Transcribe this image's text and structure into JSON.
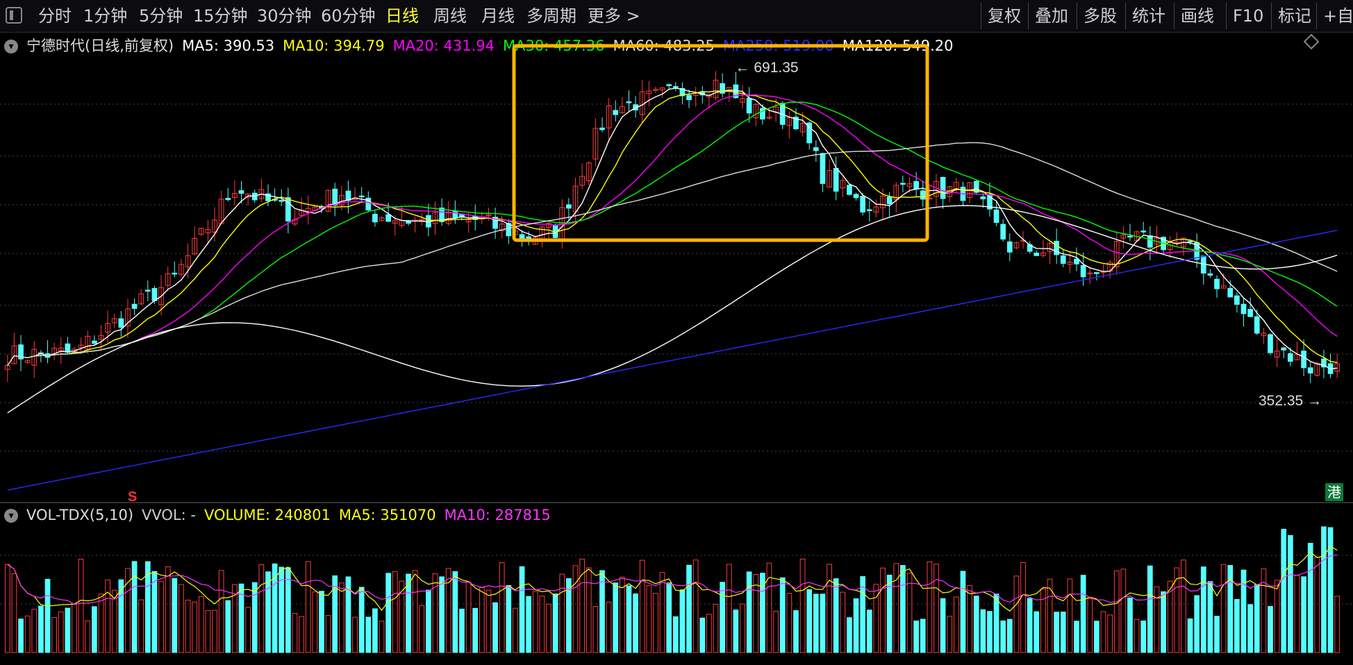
{
  "toolbar": {
    "periods": [
      "分时",
      "1分钟",
      "5分钟",
      "15分钟",
      "30分钟",
      "60分钟",
      "日线",
      "周线",
      "月线",
      "多周期",
      "更多 >"
    ],
    "active_period": "日线",
    "tools": [
      "复权",
      "叠加",
      "多股",
      "统计",
      "画线",
      "F10",
      "标记",
      "+自选"
    ]
  },
  "main_legend": {
    "title": "宁德时代(日线,前复权)",
    "items": [
      {
        "label": "MA5:",
        "value": "390.53",
        "color": "#ffffff"
      },
      {
        "label": "MA10:",
        "value": "394.79",
        "color": "#ffff00"
      },
      {
        "label": "MA20:",
        "value": "431.94",
        "color": "#ff00ff"
      },
      {
        "label": "MA30:",
        "value": "457.36",
        "color": "#00ff00"
      },
      {
        "label": "MA60:",
        "value": "483.25",
        "color": "#dddddd"
      },
      {
        "label": "MA250:",
        "value": "519.00",
        "color": "#2b2bff"
      },
      {
        "label": "MA120:",
        "value": "549.20",
        "color": "#ffffff"
      }
    ]
  },
  "volume_legend": {
    "title": "VOL-TDX(5,10)",
    "items": [
      {
        "label": "VVOL:",
        "value": "-",
        "color": "#cccccc"
      },
      {
        "label": "VOLUME:",
        "value": "240801",
        "color": "#ffff00"
      },
      {
        "label": "MA5:",
        "value": "351070",
        "color": "#ffff00"
      },
      {
        "label": "MA10:",
        "value": "287815",
        "color": "#ff33ff"
      }
    ]
  },
  "annotations": {
    "high_label": "691.35",
    "low_label": "352.35",
    "s_marker": "S",
    "hk_badge": "港"
  },
  "colors": {
    "up": "#ff3b3b",
    "down": "#55ffff",
    "highlight_box": "#ffb400",
    "grid": "#444444"
  },
  "chart_data": {
    "type": "candlestick",
    "title": "宁德时代(日线,前复权)",
    "series_count": 200,
    "price_range": [
      240,
      700
    ],
    "high": 691.35,
    "low": 352.35,
    "anchors": [
      {
        "i": 0,
        "close": 390
      },
      {
        "i": 10,
        "close": 392
      },
      {
        "i": 25,
        "close": 470
      },
      {
        "i": 34,
        "close": 565
      },
      {
        "i": 43,
        "close": 535
      },
      {
        "i": 50,
        "close": 558
      },
      {
        "i": 55,
        "close": 535
      },
      {
        "i": 62,
        "close": 528
      },
      {
        "i": 70,
        "close": 530
      },
      {
        "i": 78,
        "close": 512
      },
      {
        "i": 82,
        "close": 520
      },
      {
        "i": 90,
        "close": 645
      },
      {
        "i": 98,
        "close": 658
      },
      {
        "i": 106,
        "close": 672
      },
      {
        "i": 112,
        "close": 641
      },
      {
        "i": 118,
        "close": 635
      },
      {
        "i": 122,
        "close": 578
      },
      {
        "i": 128,
        "close": 543
      },
      {
        "i": 134,
        "close": 563
      },
      {
        "i": 140,
        "close": 560
      },
      {
        "i": 144,
        "close": 560
      },
      {
        "i": 150,
        "close": 502
      },
      {
        "i": 156,
        "close": 497
      },
      {
        "i": 162,
        "close": 470
      },
      {
        "i": 168,
        "close": 510
      },
      {
        "i": 176,
        "close": 505
      },
      {
        "i": 182,
        "close": 458
      },
      {
        "i": 188,
        "close": 407
      },
      {
        "i": 195,
        "close": 377
      },
      {
        "i": 199,
        "close": 381
      }
    ],
    "moving_averages": [
      {
        "name": "MA5",
        "color": "#ffffff",
        "last": 390.53
      },
      {
        "name": "MA10",
        "color": "#ffff00",
        "last": 394.79
      },
      {
        "name": "MA20",
        "color": "#ff00ff",
        "last": 431.94
      },
      {
        "name": "MA30",
        "color": "#00ff00",
        "last": 457.36
      },
      {
        "name": "MA60",
        "color": "#dddddd",
        "last": 483.25
      },
      {
        "name": "MA120",
        "color": "#ffffff",
        "last": 549.2
      },
      {
        "name": "MA250",
        "color": "#2b2bff",
        "last": 519.0
      }
    ],
    "volume": {
      "last": 240801,
      "ma5": 351070,
      "ma10": 287815
    }
  }
}
